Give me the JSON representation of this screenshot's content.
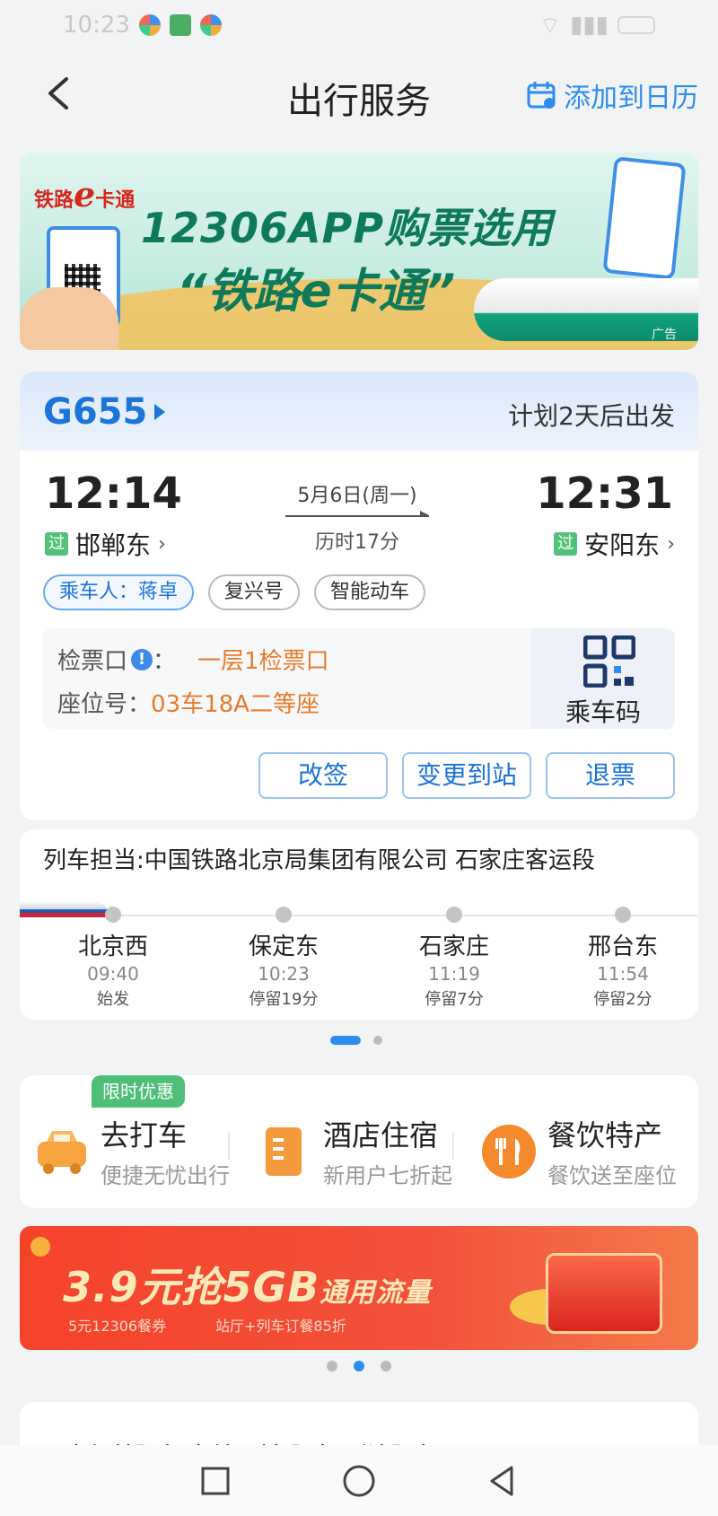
{
  "status": {
    "time": "10:23"
  },
  "header": {
    "title": "出行服务",
    "add_calendar": "添加到日历"
  },
  "ad": {
    "logo": "铁路",
    "logo_e": "e",
    "logo_suffix": "卡通",
    "line1": "12306APP购票选用",
    "line2": "“铁路e卡通”",
    "tag": "广告"
  },
  "ticket": {
    "train_no": "G655",
    "plan": "计划2天后出发",
    "dep_time": "12:14",
    "arr_time": "12:31",
    "date": "5月6日(周一)",
    "duration": "历时17分",
    "pass_tag": "过",
    "dep_station": "邯郸东",
    "arr_station": "安阳东",
    "chips": [
      "乘车人：蒋卓",
      "复兴号",
      "智能动车"
    ],
    "gate_label": "检票口",
    "gate_colon": "：",
    "gate_value": "一层1检票口",
    "seat_label": "座位号：",
    "seat_value": "03车18A二等座",
    "qr_label": "乘车码",
    "buttons": [
      "改签",
      "变更到站",
      "退票"
    ]
  },
  "route": {
    "operator": "列车担当:中国铁路北京局集团有限公司 石家庄客运段",
    "stops": [
      {
        "name": "北京西",
        "time": "09:40",
        "note": "始发"
      },
      {
        "name": "保定东",
        "time": "10:23",
        "note": "停留19分"
      },
      {
        "name": "石家庄",
        "time": "11:19",
        "note": "停留7分"
      },
      {
        "name": "邢台东",
        "time": "11:54",
        "note": "停留2分"
      }
    ]
  },
  "services": {
    "promo_tag": "限时优惠",
    "items": [
      {
        "title": "去打车",
        "sub": "便捷无忧出行",
        "icon": "taxi-icon",
        "color": "#f6a540"
      },
      {
        "title": "酒店住宿",
        "sub": "新用户七折起",
        "icon": "hotel-icon",
        "color": "#f59a3c"
      },
      {
        "title": "餐饮特产",
        "sub": "餐饮送至座位",
        "icon": "dining-icon",
        "color": "#f48a2c"
      }
    ]
  },
  "promo": {
    "main_a": "3.9元抢5GB",
    "main_b": "通用流量",
    "sub1": "5元12306餐券",
    "sub2": "站厅+列车订餐85折"
  },
  "bottom": {
    "text": "出行首服务    车站/列车服务    到达服务"
  },
  "colors": {
    "accent": "#2d8cf0",
    "orange": "#e87b2a",
    "green": "#52c27a"
  }
}
